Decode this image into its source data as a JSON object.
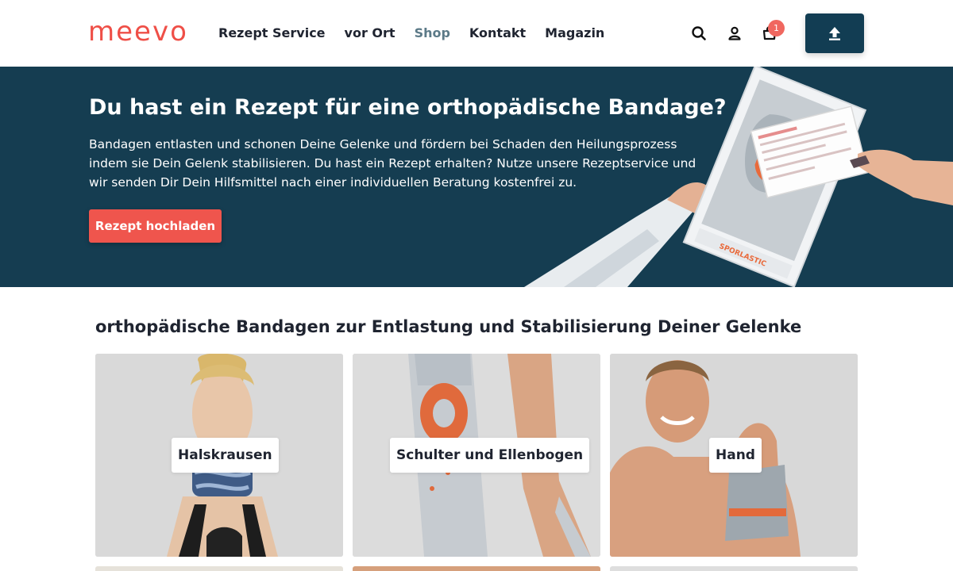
{
  "header": {
    "logo": "meevo",
    "nav": [
      {
        "label": "Rezept Service",
        "active": false
      },
      {
        "label": "vor Ort",
        "active": false
      },
      {
        "label": "Shop",
        "active": true
      },
      {
        "label": "Kontakt",
        "active": false
      },
      {
        "label": "Magazin",
        "active": false
      }
    ],
    "icons": [
      "search-icon",
      "user-icon",
      "cart-icon",
      "upload-icon"
    ],
    "cart_count": "1"
  },
  "hero": {
    "title": "Du hast ein Rezept für eine orthopädische Bandage?",
    "text": "Bandagen entlasten und schonen Deine Gelenke und fördern bei Schaden den Heilungsprozess indem sie Dein Gelenk stabilisieren. Du hast ein Rezept erhalten? Nutze unsere Rezeptservice und wir senden Dir Dein Hilfsmittel nach einer individuellen Beratung kostenfrei zu.",
    "cta": "Rezept hochladen",
    "box_brand": "SPORLASTIC"
  },
  "section": {
    "title": "orthopädische Bandagen zur Entlastung und Stabilisierung Deiner Gelenke",
    "categories": [
      {
        "label": "Halskrausen"
      },
      {
        "label": "Schulter und Ellenbogen"
      },
      {
        "label": "Hand"
      }
    ]
  },
  "colors": {
    "brand": "#ef4f47",
    "hero_bg": "#153d51",
    "cta": "#ef554d",
    "nav_active": "#5c7a88",
    "upload_btn": "#123d53"
  }
}
